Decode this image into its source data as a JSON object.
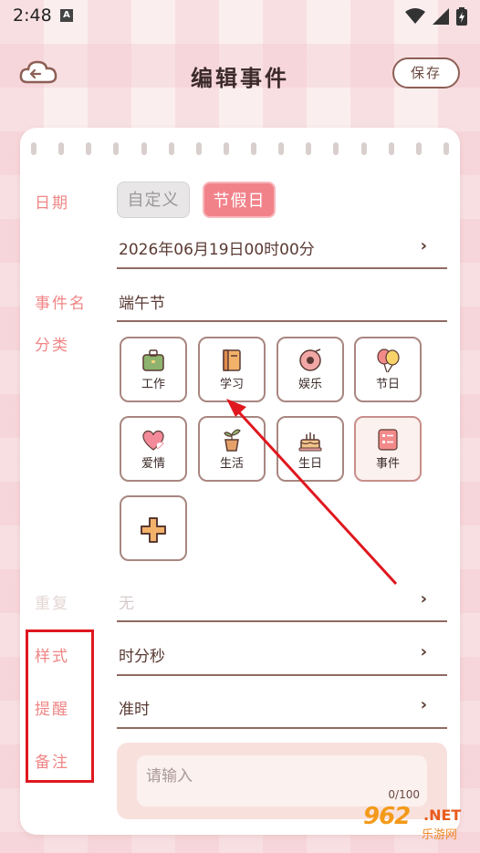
{
  "status": {
    "time": "2:48",
    "notif_letter": "A"
  },
  "header": {
    "title": "编辑事件",
    "save_label": "保存"
  },
  "form": {
    "date_label": "日期",
    "date_modes": [
      "自定义",
      "节假日"
    ],
    "date_value": "2026年06月19日00时00分",
    "name_label": "事件名",
    "name_value": "端午节",
    "category_label": "分类",
    "categories": [
      {
        "label": "工作",
        "icon": "briefcase-icon"
      },
      {
        "label": "学习",
        "icon": "book-icon"
      },
      {
        "label": "娱乐",
        "icon": "record-icon"
      },
      {
        "label": "节日",
        "icon": "balloon-icon"
      },
      {
        "label": "爱情",
        "icon": "heart-icon"
      },
      {
        "label": "生活",
        "icon": "plant-icon"
      },
      {
        "label": "生日",
        "icon": "cake-icon"
      },
      {
        "label": "事件",
        "icon": "note-icon"
      }
    ],
    "selected_category": "事件",
    "repeat_label": "重复",
    "repeat_value": "无",
    "style_label": "样式",
    "style_value": "时分秒",
    "reminder_label": "提醒",
    "reminder_value": "准时",
    "note_label": "备注",
    "note_placeholder": "请输入",
    "note_count": "0/100"
  },
  "watermark": {
    "brand": "962",
    "domain": ".NET",
    "sub": "乐游网"
  },
  "colors": {
    "accent": "#f2828a",
    "label": "#f08585",
    "annotation": "#e0171f"
  }
}
